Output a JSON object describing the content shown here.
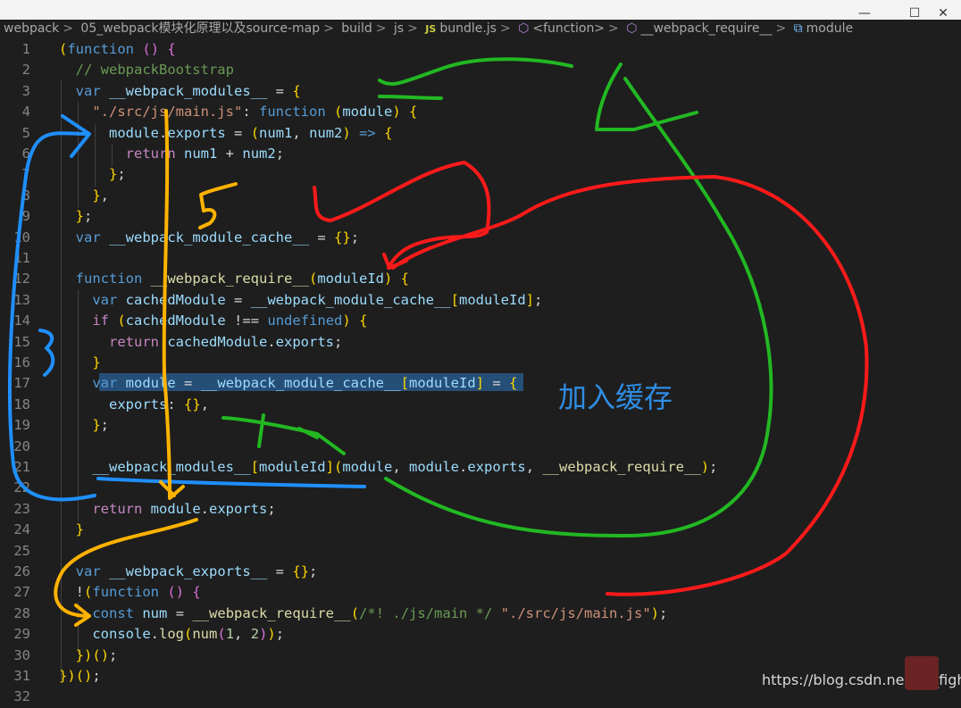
{
  "window_controls": {
    "minimize": "—",
    "maximize": "☐",
    "close": "✕"
  },
  "breadcrumb": {
    "items": [
      "webpack",
      "05_webpack模块化原理以及source-map",
      "build",
      "js",
      "bundle.js",
      "<function>",
      "__webpack_require__",
      "module"
    ],
    "js_badge": "JS",
    "separator": ">"
  },
  "lines": [
    {
      "n": "1",
      "t": "(function () {"
    },
    {
      "n": "2",
      "t": "  // webpackBootstrap"
    },
    {
      "n": "3",
      "t": "  var __webpack_modules__ = {"
    },
    {
      "n": "4",
      "t": "    \"./src/js/main.js\": function (module) {"
    },
    {
      "n": "5",
      "t": "      module.exports = (num1, num2) => {"
    },
    {
      "n": "6",
      "t": "        return num1 + num2;"
    },
    {
      "n": "7",
      "t": "      };"
    },
    {
      "n": "8",
      "t": "    },"
    },
    {
      "n": "9",
      "t": "  };"
    },
    {
      "n": "10",
      "t": "  var __webpack_module_cache__ = {};"
    },
    {
      "n": "11",
      "t": ""
    },
    {
      "n": "12",
      "t": "  function __webpack_require__(moduleId) {"
    },
    {
      "n": "13",
      "t": "    var cachedModule = __webpack_module_cache__[moduleId];"
    },
    {
      "n": "14",
      "t": "    if (cachedModule !== undefined) {"
    },
    {
      "n": "15",
      "t": "      return cachedModule.exports;"
    },
    {
      "n": "16",
      "t": "    }"
    },
    {
      "n": "17",
      "t": "    var module = __webpack_module_cache__[moduleId] = {"
    },
    {
      "n": "18",
      "t": "      exports: {},"
    },
    {
      "n": "19",
      "t": "    };"
    },
    {
      "n": "20",
      "t": ""
    },
    {
      "n": "21",
      "t": "    __webpack_modules__[moduleId](module, module.exports, __webpack_require__);"
    },
    {
      "n": "22",
      "t": ""
    },
    {
      "n": "23",
      "t": "    return module.exports;"
    },
    {
      "n": "24",
      "t": "  }"
    },
    {
      "n": "25",
      "t": ""
    },
    {
      "n": "26",
      "t": "  var __webpack_exports__ = {};"
    },
    {
      "n": "27",
      "t": "  !(function () {"
    },
    {
      "n": "28",
      "t": "    const num = __webpack_require__(/*! ./js/main */ \"./src/js/main.js\");"
    },
    {
      "n": "29",
      "t": "    console.log(num(1, 2));"
    },
    {
      "n": "30",
      "t": "  })();"
    },
    {
      "n": "31",
      "t": "})();"
    },
    {
      "n": "32",
      "t": ""
    }
  ],
  "annotation": "加入缓存",
  "watermark": "https://blog.csdn.net/lin_fightin",
  "colors": {
    "blue_ink": "#1f8fff",
    "green_ink": "#22b822",
    "red_ink": "#ff1a1a",
    "yellow_ink": "#ffb300"
  }
}
